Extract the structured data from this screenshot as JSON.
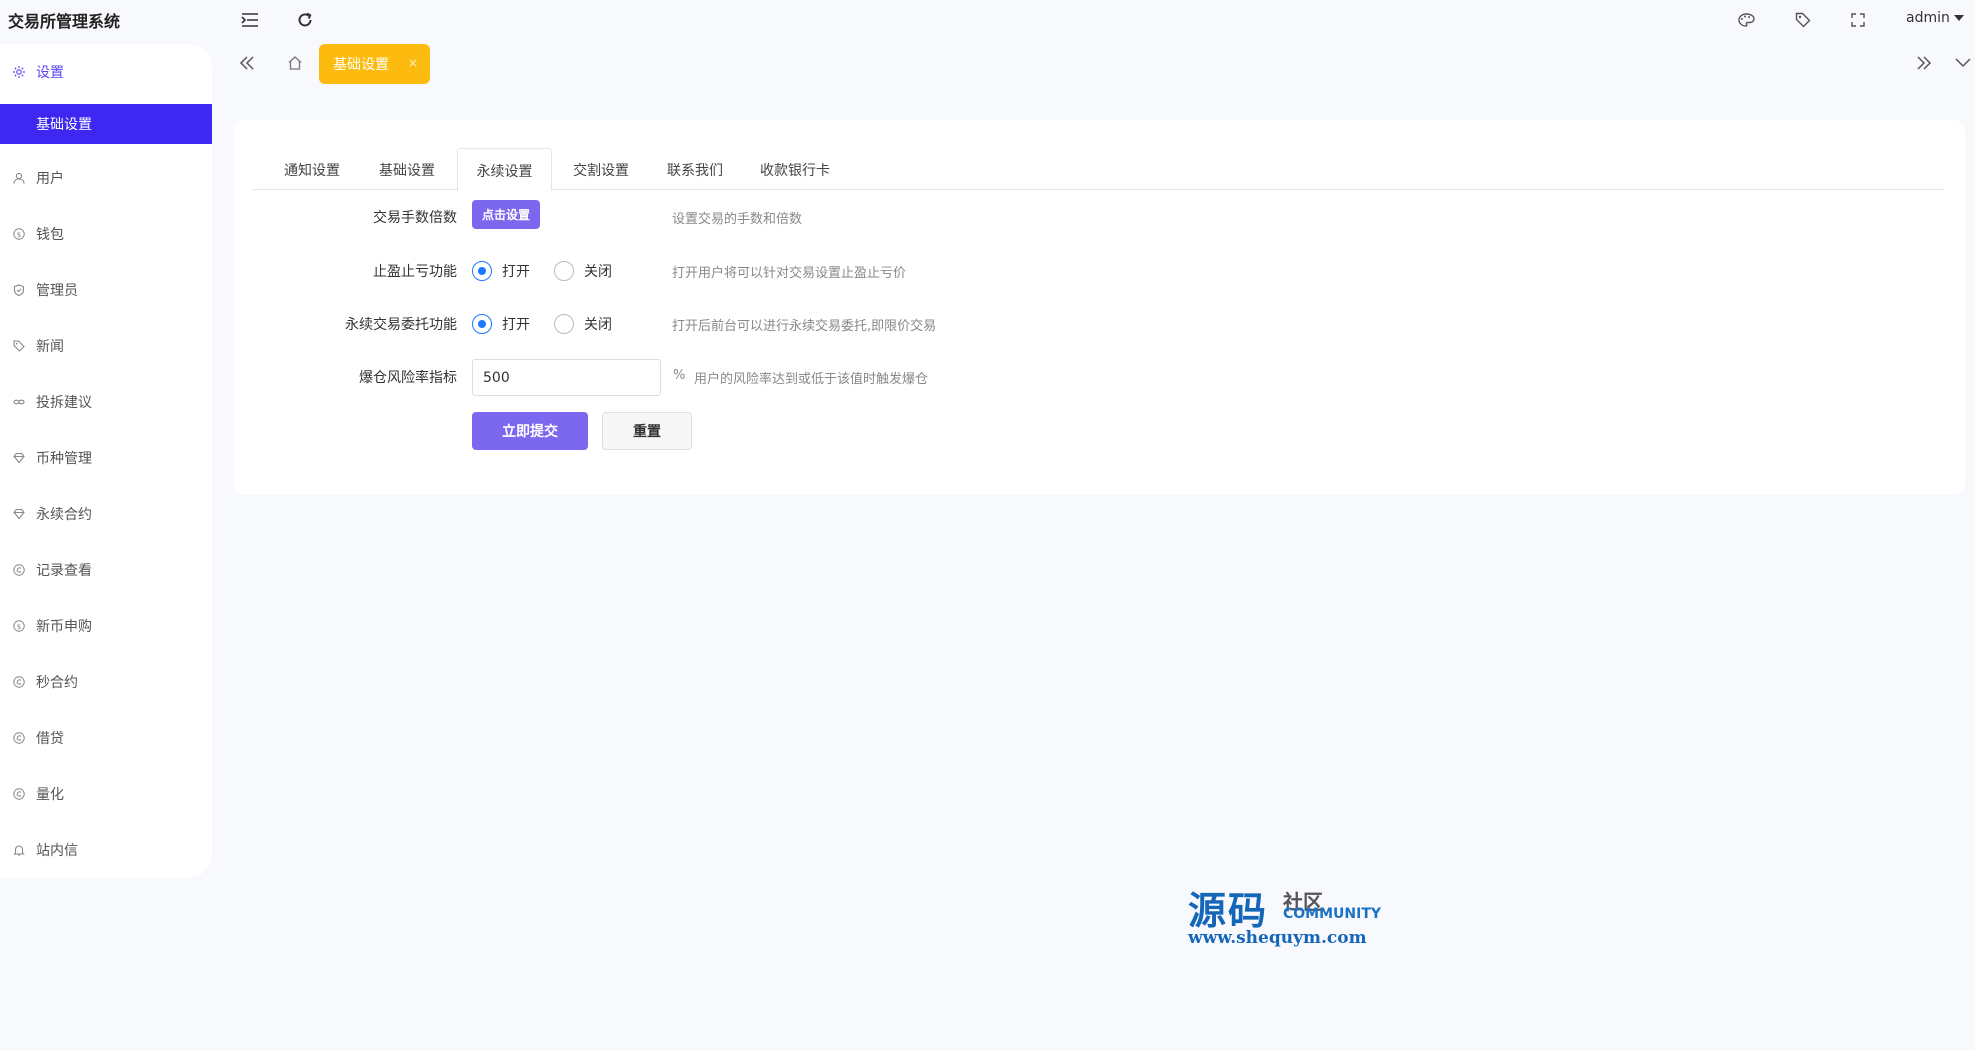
{
  "header": {
    "app_title": "交易所管理系统",
    "user": "admin"
  },
  "tabstrip": {
    "active_tab": "基础设置",
    "close_glyph": "×"
  },
  "sidebar": {
    "items": [
      {
        "label": "设置",
        "icon": "gear-icon"
      },
      {
        "label": "用户",
        "icon": "user-icon"
      },
      {
        "label": "钱包",
        "icon": "dollar-icon"
      },
      {
        "label": "管理员",
        "icon": "shield-icon"
      },
      {
        "label": "新闻",
        "icon": "tag-icon"
      },
      {
        "label": "投拆建议",
        "icon": "link-icon"
      },
      {
        "label": "币种管理",
        "icon": "diamond-icon"
      },
      {
        "label": "永续合约",
        "icon": "diamond-icon"
      },
      {
        "label": "记录查看",
        "icon": "copyright-icon"
      },
      {
        "label": "新币申购",
        "icon": "dollar-icon"
      },
      {
        "label": "秒合约",
        "icon": "copyright-icon"
      },
      {
        "label": "借贷",
        "icon": "copyright-icon"
      },
      {
        "label": "量化",
        "icon": "copyright-icon"
      },
      {
        "label": "站内信",
        "icon": "bell-icon"
      }
    ],
    "active_sub": "基础设置"
  },
  "settings": {
    "tabs": [
      "通知设置",
      "基础设置",
      "永续设置",
      "交割设置",
      "联系我们",
      "收款银行卡"
    ],
    "active_tab_index": 2,
    "fee": {
      "label": "交易手数倍数",
      "button": "点击设置",
      "help": "设置交易的手数和倍数"
    },
    "stop": {
      "label": "止盈止亏功能",
      "on": "打开",
      "off": "关闭",
      "help": "打开用户将可以针对交易设置止盈止亏价"
    },
    "entrust": {
      "label": "永续交易委托功能",
      "on": "打开",
      "off": "关闭",
      "help": "打开后前台可以进行永续交易委托,即限价交易"
    },
    "risk": {
      "label": "爆仓风险率指标",
      "value": "500",
      "unit": "%",
      "help": "用户的风险率达到或低于该值时触发爆仓"
    },
    "submit": "立即提交",
    "reset": "重置"
  },
  "watermark": {
    "main": "源码",
    "side": "社区",
    "community": "COMMUNITY",
    "url": "www.shequym.com"
  },
  "colors": {
    "accent": "#3e27f0",
    "button": "#7b68ee",
    "tab_highlight": "#fdba0f",
    "radio": "#1e78ff"
  }
}
